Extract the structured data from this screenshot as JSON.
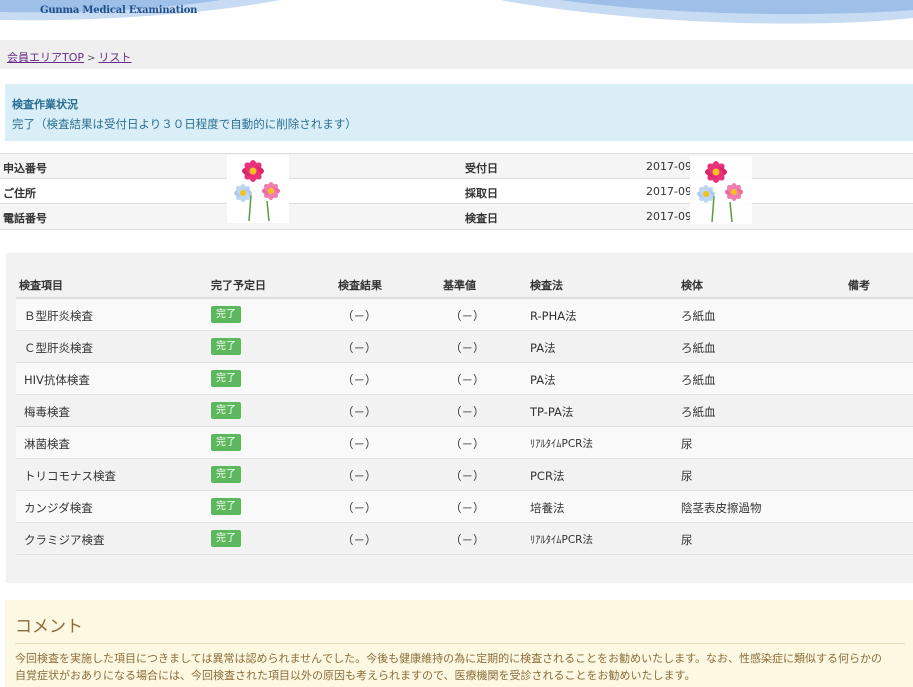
{
  "header": {
    "logo": "Gunma Medical Examination"
  },
  "breadcrumb": {
    "top_link": "会員エリアTOP",
    "separator": ">",
    "current_link": "リスト"
  },
  "status": {
    "title": "検査作業状況",
    "message": "完了（検査結果は受付日より３０日程度で自動的に削除されます）"
  },
  "info": {
    "rows": [
      {
        "label": "申込番号",
        "label2": "受付日",
        "value2": "2017-09-"
      },
      {
        "label": "ご住所",
        "label2": "採取日",
        "value2": "2017-09-"
      },
      {
        "label": "電話番号",
        "label2": "検査日",
        "value2": "2017-09-"
      }
    ]
  },
  "results": {
    "headers": [
      "検査項目",
      "完了予定日",
      "検査結果",
      "基準値",
      "検査法",
      "検体",
      "備考"
    ],
    "rows": [
      {
        "item": "Ｂ型肝炎検査",
        "status": "完了",
        "result": "（－）",
        "reference": "（－）",
        "method": "R-PHA法",
        "specimen": "ろ紙血",
        "note": ""
      },
      {
        "item": "Ｃ型肝炎検査",
        "status": "完了",
        "result": "（－）",
        "reference": "（－）",
        "method": "PA法",
        "specimen": "ろ紙血",
        "note": ""
      },
      {
        "item": "HIV抗体検査",
        "status": "完了",
        "result": "（－）",
        "reference": "（－）",
        "method": "PA法",
        "specimen": "ろ紙血",
        "note": ""
      },
      {
        "item": "梅毒検査",
        "status": "完了",
        "result": "（－）",
        "reference": "（－）",
        "method": "TP-PA法",
        "specimen": "ろ紙血",
        "note": ""
      },
      {
        "item": "淋菌検査",
        "status": "完了",
        "result": "（－）",
        "reference": "（－）",
        "method": "ﾘｱﾙﾀｲﾑPCR法",
        "specimen": "尿",
        "note": ""
      },
      {
        "item": "トリコモナス検査",
        "status": "完了",
        "result": "（－）",
        "reference": "（－）",
        "method": "PCR法",
        "specimen": "尿",
        "note": ""
      },
      {
        "item": "カンジダ検査",
        "status": "完了",
        "result": "（－）",
        "reference": "（－）",
        "method": "培養法",
        "specimen": "陰茎表皮擦過物",
        "note": ""
      },
      {
        "item": "クラミジア検査",
        "status": "完了",
        "result": "（－）",
        "reference": "（－）",
        "method": "ﾘｱﾙﾀｲﾑPCR法",
        "specimen": "尿",
        "note": ""
      }
    ]
  },
  "comment": {
    "title": "コメント",
    "line1": "今回検査を実施した項目につきましては異常は認められませんでした。今後も健康維持の為に定期的に検査されることをお勧めいたします。なお、性感染症に類似する何らかの",
    "line2": "自覚症状がおありになる場合には、今回検査された項目以外の原因も考えられますので、医療機関を受診されることをお勧めいたします。"
  },
  "colors": {
    "status_bg": "#daeef8",
    "status_text": "#2a6f93",
    "badge": "#5cb85c",
    "comment_bg": "#fdf8e1",
    "comment_text": "#8a6d3b",
    "link": "#6a2c86"
  },
  "icons": {
    "flower": "cosmos-flower-icon"
  }
}
